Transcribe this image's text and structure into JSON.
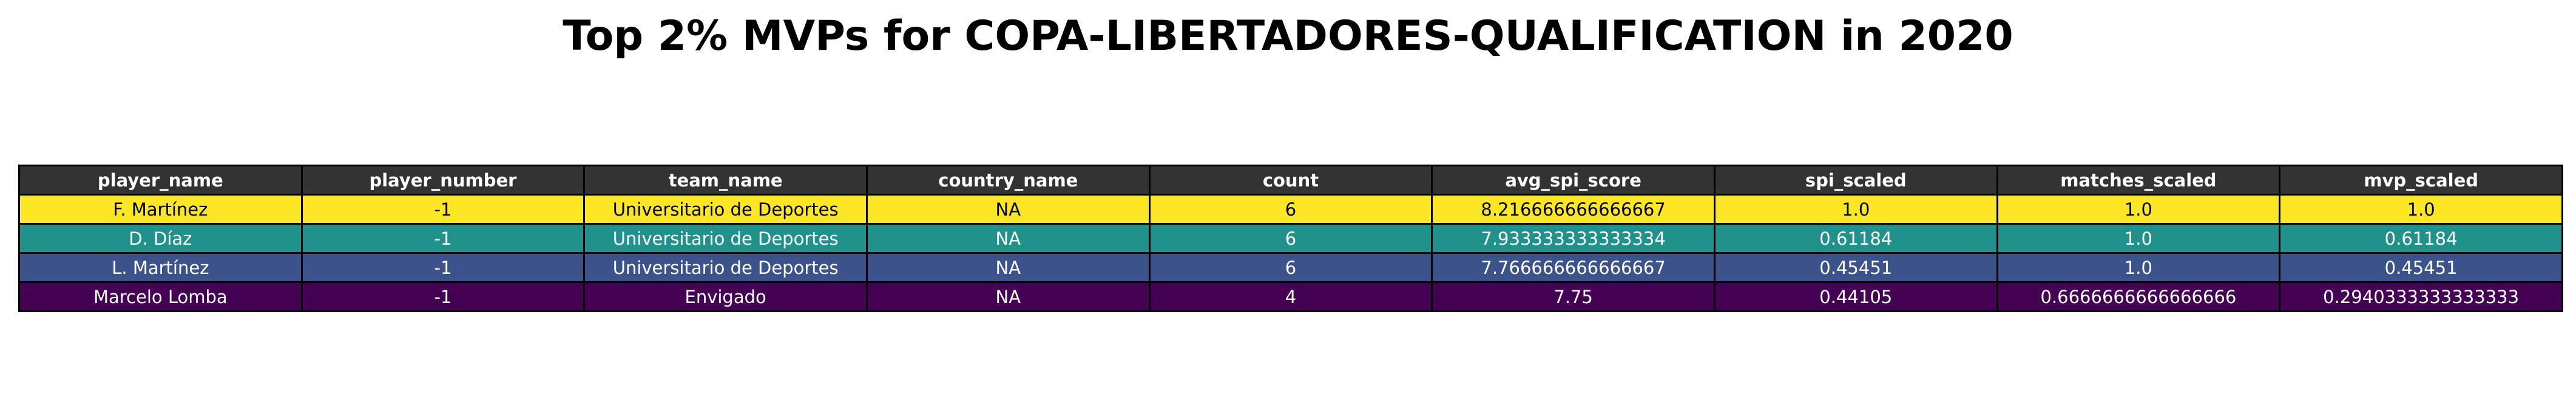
{
  "title": "Top 2% MVPs for COPA-LIBERTADORES-QUALIFICATION in 2020",
  "colors": {
    "header_bg": "#333333",
    "header_text": "#ffffff",
    "row_bg": [
      "#fde725",
      "#21918c",
      "#3b528b",
      "#440154"
    ],
    "row_text": [
      "#000000",
      "#ffffff",
      "#ffffff",
      "#ffffff"
    ]
  },
  "chart_data": {
    "type": "table",
    "title": "Top 2% MVPs for COPA-LIBERTADORES-QUALIFICATION in 2020",
    "columns": [
      "player_name",
      "player_number",
      "team_name",
      "country_name",
      "count",
      "avg_spi_score",
      "spi_scaled",
      "matches_scaled",
      "mvp_scaled"
    ],
    "rows": [
      [
        "F. Martínez",
        "-1",
        "Universitario de Deportes",
        "NA",
        "6",
        "8.216666666666667",
        "1.0",
        "1.0",
        "1.0"
      ],
      [
        "D. Díaz",
        "-1",
        "Universitario de Deportes",
        "NA",
        "6",
        "7.933333333333334",
        "0.61184",
        "1.0",
        "0.61184"
      ],
      [
        "L. Martínez",
        "-1",
        "Universitario de Deportes",
        "NA",
        "6",
        "7.766666666666667",
        "0.45451",
        "1.0",
        "0.45451"
      ],
      [
        "Marcelo Lomba",
        "-1",
        "Envigado",
        "NA",
        "4",
        "7.75",
        "0.44105",
        "0.6666666666666666",
        "0.2940333333333333"
      ]
    ]
  }
}
